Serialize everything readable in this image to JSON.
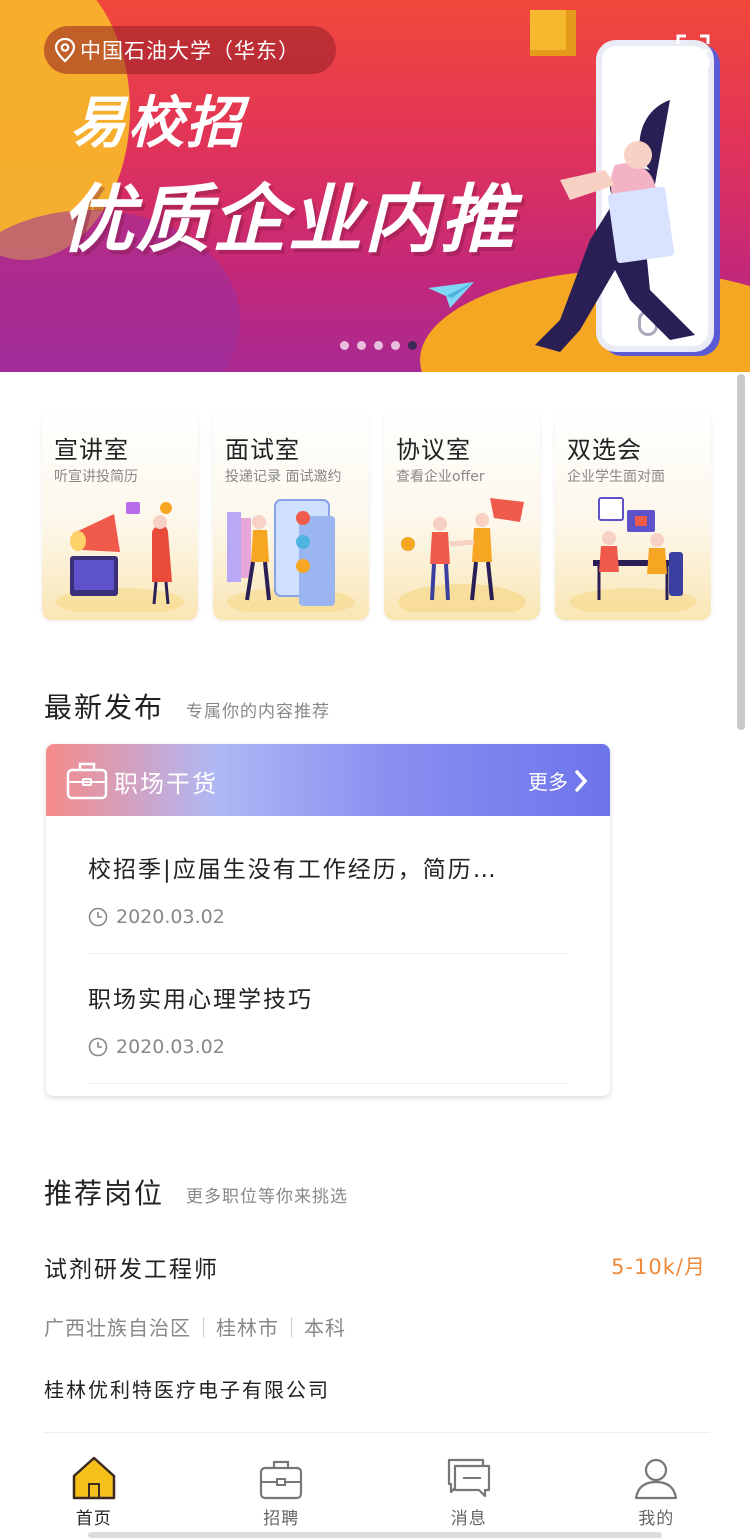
{
  "banner": {
    "location": "中国石油大学（华东）",
    "title_small": "易校招",
    "title_big": "优质企业内推",
    "slide_count": 5,
    "active_slide": 5
  },
  "features": [
    {
      "title": "宣讲室",
      "subtitle": "听宣讲投简历"
    },
    {
      "title": "面试室",
      "subtitle": "投递记录 面试邀约"
    },
    {
      "title": "协议室",
      "subtitle": "查看企业offer"
    },
    {
      "title": "双选会",
      "subtitle": "企业学生面对面"
    }
  ],
  "latest": {
    "title": "最新发布",
    "subtitle": "专属你的内容推荐",
    "card_title": "职场干货",
    "more": "更多",
    "items": [
      {
        "title": "校招季|应届生没有工作经历，简历…",
        "date": "2020.03.02"
      },
      {
        "title": "职场实用心理学技巧",
        "date": "2020.03.02"
      }
    ]
  },
  "jobs": {
    "title": "推荐岗位",
    "subtitle": "更多职位等你来挑选",
    "items": [
      {
        "title": "试剂研发工程师",
        "salary": "5-10k/月",
        "region": "广西壮族自治区",
        "city": "桂林市",
        "degree": "本科",
        "company": "桂林优利特医疗电子有限公司"
      }
    ]
  },
  "tabbar": [
    {
      "label": "首页",
      "icon": "home-icon",
      "active": true
    },
    {
      "label": "招聘",
      "icon": "briefcase-icon",
      "active": false
    },
    {
      "label": "消息",
      "icon": "message-icon",
      "active": false
    },
    {
      "label": "我的",
      "icon": "user-icon",
      "active": false
    }
  ],
  "colors": {
    "accent": "#f5c01a",
    "salary": "#f08a3a",
    "banner_red": "#e0335a",
    "banner_purple": "#a92a92"
  }
}
